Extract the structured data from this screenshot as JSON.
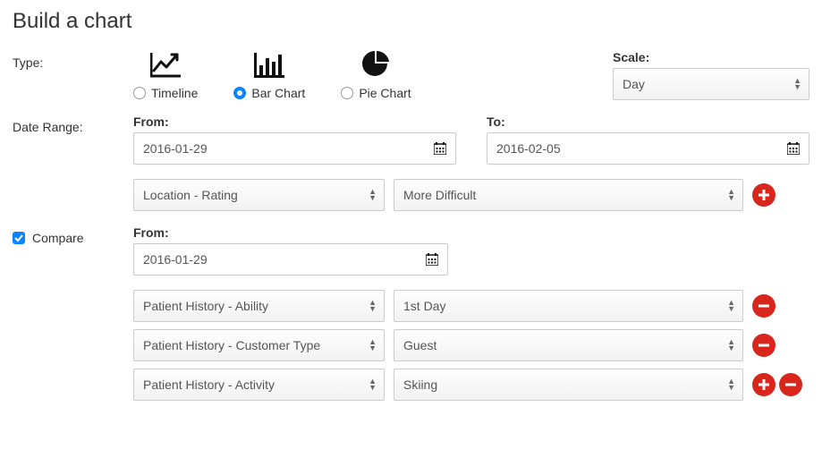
{
  "title": "Build a chart",
  "labels": {
    "type": "Type:",
    "scale": "Scale:",
    "dateRange": "Date Range:",
    "compare": "Compare",
    "from": "From:",
    "to": "To:"
  },
  "types": {
    "timeline": "Timeline",
    "bar": "Bar Chart",
    "pie": "Pie Chart"
  },
  "scale": {
    "value": "Day"
  },
  "daterange": {
    "from": "2016-01-29",
    "to": "2016-02-05"
  },
  "filter1": {
    "field": "Location - Rating",
    "value": "More Difficult"
  },
  "compare": {
    "from": "2016-01-29",
    "filters": [
      {
        "field": "Patient History - Ability",
        "value": "1st Day"
      },
      {
        "field": "Patient History - Customer Type",
        "value": "Guest"
      },
      {
        "field": "Patient History - Activity",
        "value": "Skiing"
      }
    ]
  }
}
